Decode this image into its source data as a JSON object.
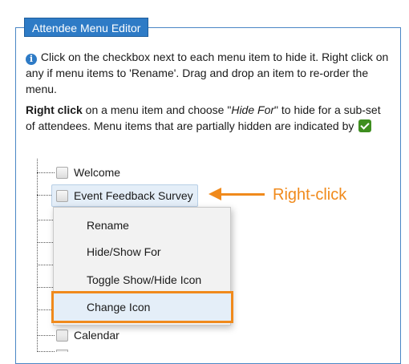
{
  "panel": {
    "legend": "Attendee Menu Editor"
  },
  "instructions": {
    "info_icon": "i",
    "line1": "Click on the checkbox next to each menu item to hide it. Right click on any if menu items to 'Rename'. Drag and drop an item to re-order the menu.",
    "line2_bold": "Right click",
    "line2_a": " on a menu item and choose \"",
    "line2_italic": "Hide For",
    "line2_b": "\" to hide for a sub-set of attendees. Menu items that are partially hidden are indicated by"
  },
  "tree": {
    "items": [
      {
        "label": "Welcome"
      },
      {
        "label": "Event Feedback Survey"
      },
      {
        "label": "Calendar"
      }
    ]
  },
  "annotation": {
    "callout": "Right-click",
    "color": "#f08a1c"
  },
  "context_menu": {
    "items": [
      {
        "label": "Rename"
      },
      {
        "label": "Hide/Show For"
      },
      {
        "label": "Toggle Show/Hide Icon"
      },
      {
        "label": "Change Icon"
      }
    ]
  }
}
